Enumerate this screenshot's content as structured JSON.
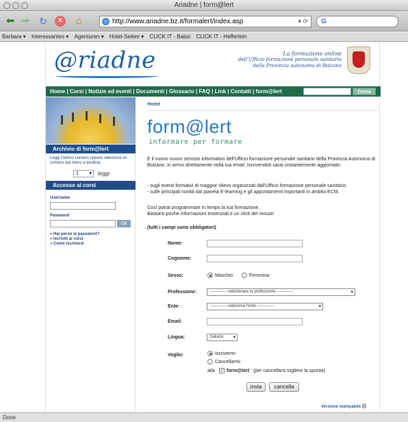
{
  "window": {
    "title": "Ariadne | form@lert"
  },
  "toolbar": {
    "address": "http://www.ariadne.bz.it/formalert/index.asp",
    "search_value": "G"
  },
  "bookmarks": [
    "Barbara ▾",
    "Interessantes ▾",
    "Agenturen ▾",
    "Hotel-Seiten ▾",
    "CLICK IT - Babsi",
    "CLICK IT - Hefferlein"
  ],
  "site": {
    "logo": "@riadne",
    "tagline": [
      "La formazione online",
      "dell'Ufficio formazione personale sanitario",
      "della Provincia autonoma di Bolzano"
    ],
    "nav": "Home | Corsi | Notizie ed eventi | Documenti | Glossario | FAQ | Link | Contatti | form@lert",
    "search_button": "Cerca"
  },
  "sidebar": {
    "archivio_header": "Archivio di form@lert",
    "archivio_text": "Leggi l'ultimo numero oppure seleziona un numero dal menù a tendina:",
    "numero_value": "1",
    "leggi": "leggi",
    "accesso_header": "Accesso ai corsi",
    "username_label": "Username",
    "password_label": "Password",
    "ok": "Ok",
    "links": [
      "» Hai perso la password?",
      "» Iscriviti ai corsi",
      "» Come iscriversi"
    ]
  },
  "main": {
    "breadcrumb": "Home",
    "brand": "form@lert",
    "brand_sub": "informare per formare",
    "intro": "È il nuovo nuovo servizio informativo dell'Ufficio formazione personale sanitario della Provincia Autonoma di Bolzano, in arrivo direttamente nella tua email. Iscrivendoti sarai costantemente aggiornato:",
    "bullets": "- sugli eventi formativi di maggior rilievo organizzati dall'Ufficio formazione personale sanitario;\n- sulle principali novità dal pianeta E-learning e gli appuntamenti importanti in ambito ECM.",
    "closing": "Così potrai programmare in tempo la tua formazione.\nBastano poche informazioni essenziali e un click del mouse:",
    "form_note": "(tutti i campi sono obbligatori)"
  },
  "form": {
    "nome_label": "Nome:",
    "cognome_label": "Cognome:",
    "sesso_label": "Sesso:",
    "maschio": "Maschio",
    "femmina": "Femmina",
    "professione_label": "Professione:",
    "professione_value": "------------ selezionare la professione ------------",
    "ente_label": "Ente:",
    "ente_value": "------------ seleziona l'ente ------------",
    "email_label": "Email:",
    "lingua_label": "Lingua:",
    "lingua_value": "Italiano",
    "voglio_label": "Voglio:",
    "iscrivermi": "Iscrivermi",
    "cancellarmi": "Cancellarmi",
    "alla": "alla",
    "formalert_bold": "form@lert",
    "formalert_note": "(per cancellarsi togliere la spunta)",
    "invia": "invia",
    "cancella": "cancella",
    "print": "Versione stampabile"
  },
  "status": {
    "text": "Done"
  }
}
